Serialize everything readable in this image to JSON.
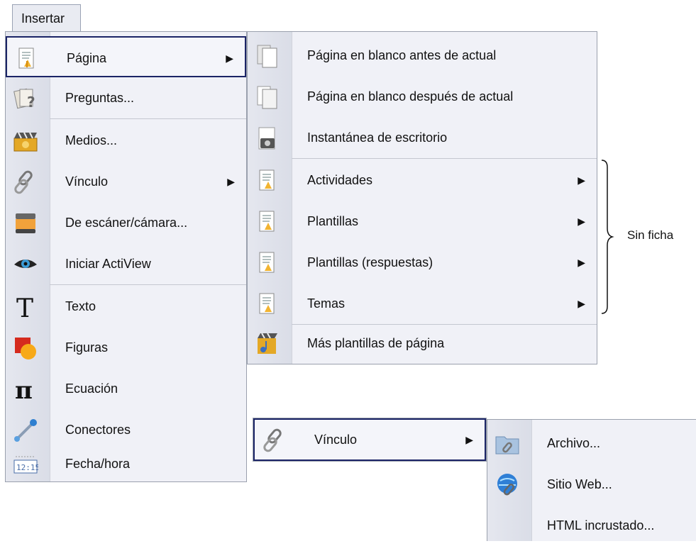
{
  "menubar": {
    "insertar_label": "Insertar"
  },
  "main_menu": {
    "items": [
      {
        "label": "Página",
        "icon": "page-icon",
        "has_submenu": true
      },
      {
        "label": "Preguntas...",
        "icon": "questions-icon"
      },
      {
        "label": "Medios...",
        "icon": "media-icon"
      },
      {
        "label": "Vínculo",
        "icon": "link-icon",
        "has_submenu": true
      },
      {
        "label": "De escáner/cámara...",
        "icon": "scanner-icon"
      },
      {
        "label": "Iniciar ActiView",
        "icon": "eye-icon"
      },
      {
        "label": "Texto",
        "icon": "text-icon"
      },
      {
        "label": "Figuras",
        "icon": "shapes-icon"
      },
      {
        "label": "Ecuación",
        "icon": "pi-icon"
      },
      {
        "label": "Conectores",
        "icon": "connector-icon"
      },
      {
        "label": "Fecha/hora",
        "icon": "date-time-icon"
      }
    ]
  },
  "page_submenu": {
    "items": [
      {
        "label": "Página en blanco antes de actual",
        "icon": "blank-page-before-icon"
      },
      {
        "label": "Página en blanco después de actual",
        "icon": "blank-page-after-icon"
      },
      {
        "label": "Instantánea de escritorio",
        "icon": "desktop-snapshot-icon"
      },
      {
        "label": "Actividades",
        "icon": "page-icon",
        "has_submenu": true
      },
      {
        "label": "Plantillas",
        "icon": "page-icon",
        "has_submenu": true
      },
      {
        "label": "Plantillas (respuestas)",
        "icon": "page-icon",
        "has_submenu": true
      },
      {
        "label": "Temas",
        "icon": "page-icon",
        "has_submenu": true
      },
      {
        "label": "Más plantillas de página",
        "icon": "media-page-icon"
      }
    ]
  },
  "annotation": {
    "text": "Sin ficha"
  },
  "link_item": {
    "label": "Vínculo",
    "icon": "link-icon"
  },
  "link_submenu": {
    "items": [
      {
        "label": "Archivo...",
        "icon": "folder-link-icon"
      },
      {
        "label": "Sitio Web...",
        "icon": "web-link-icon"
      },
      {
        "label": "HTML incrustado...",
        "icon": ""
      }
    ]
  },
  "colors": {
    "menu_bg": "#f0f1f7",
    "highlight_border": "#1b2466",
    "separator": "#c4c7d0"
  }
}
